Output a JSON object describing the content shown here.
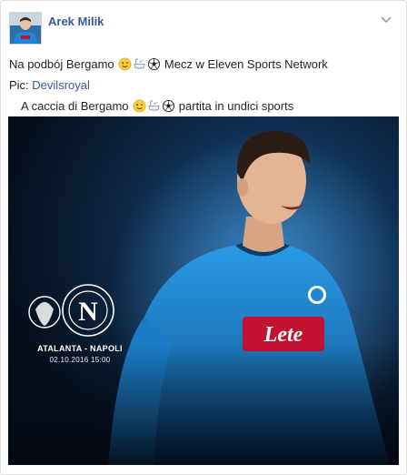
{
  "post": {
    "author": "Arek Milik",
    "line1_before": "Na podbój Bergamo",
    "line1_after": "Mecz w Eleven Sports Network",
    "line2_label": "Pic: ",
    "line2_link": "Devilsroyal",
    "line3_before": "A caccia di Bergamo",
    "line3_after": "partita in undici sports"
  },
  "photo": {
    "match": "ATALANTA - NAPOLI",
    "date": "02.10.2016 15:00",
    "sponsor": "Lete",
    "club_badge_letter": "N"
  },
  "icons": [
    "winking-face-icon",
    "bath-icon",
    "soccer-ball-icon",
    "chevron-down-icon"
  ],
  "colors": {
    "author": "#365899",
    "link": "#365899",
    "jersey": "#1e88d6",
    "background": "#0a1a2f"
  }
}
